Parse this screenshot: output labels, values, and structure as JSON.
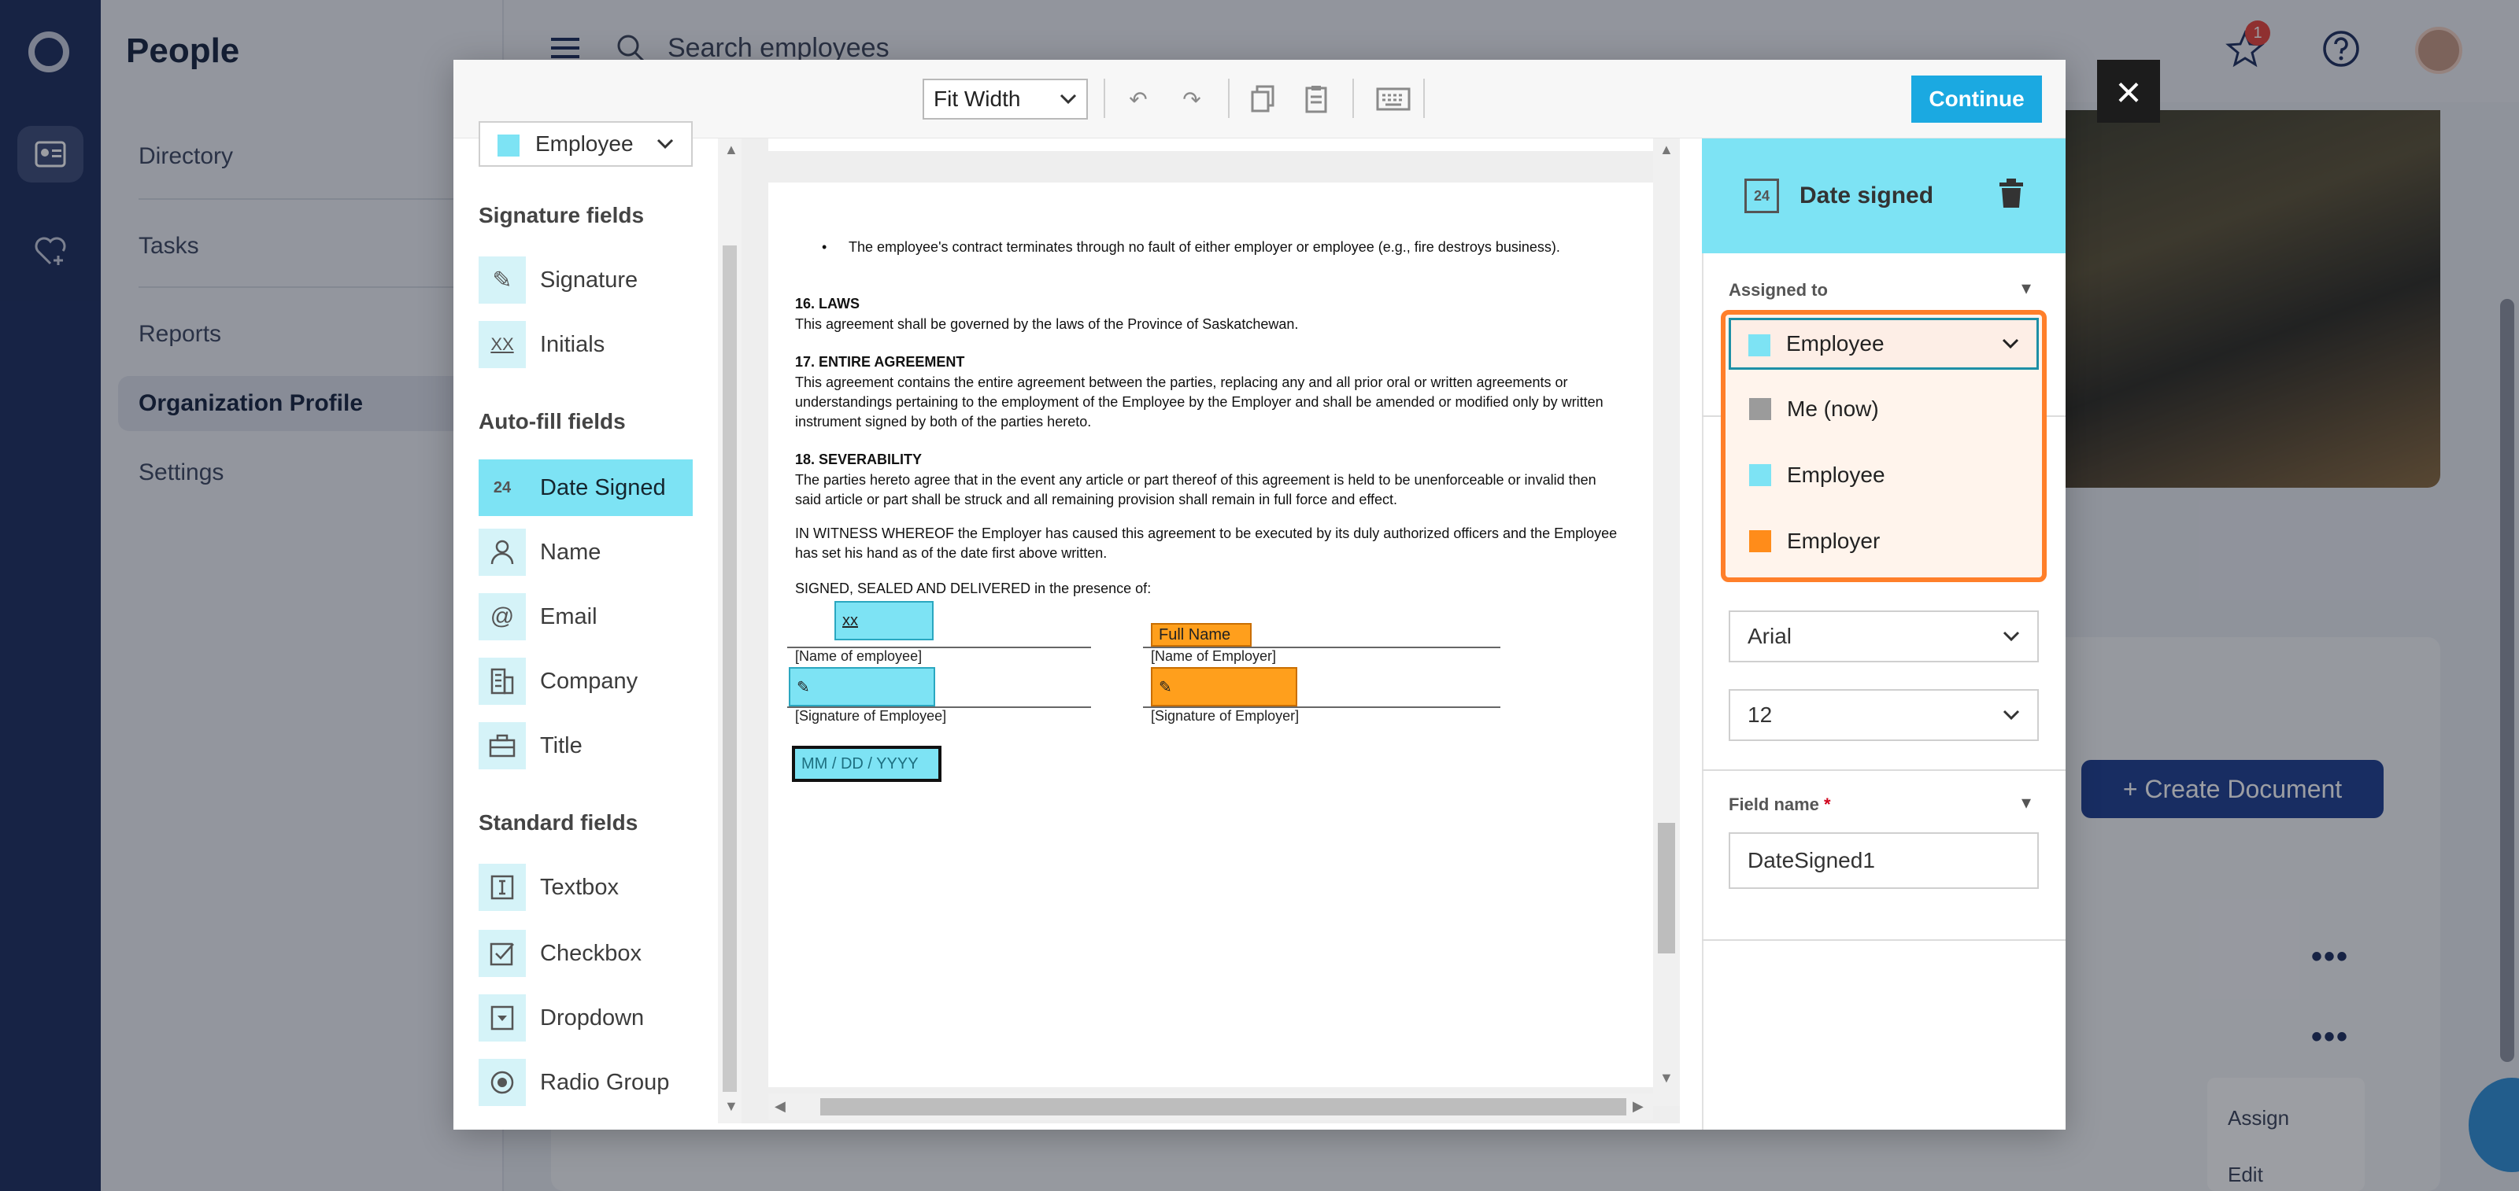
{
  "app": {
    "title": "People",
    "search_placeholder": "Search employees",
    "notification_count": "1"
  },
  "sidebar": {
    "items": [
      {
        "label": "Directory"
      },
      {
        "label": "Tasks"
      },
      {
        "label": "Reports"
      },
      {
        "label": "Organization Profile"
      },
      {
        "label": "Settings"
      }
    ]
  },
  "background": {
    "create_document_label": "+ Create Document",
    "context_menu": [
      "Assign",
      "Edit"
    ]
  },
  "modal": {
    "zoom_value": "Fit Width",
    "continue_label": "Continue",
    "left_panel": {
      "assignee": "Employee",
      "sections": [
        {
          "heading": "Signature fields",
          "items": [
            "Signature",
            "Initials"
          ]
        },
        {
          "heading": "Auto-fill fields",
          "items": [
            "Date Signed",
            "Name",
            "Email",
            "Company",
            "Title"
          ]
        },
        {
          "heading": "Standard fields",
          "items": [
            "Textbox",
            "Checkbox",
            "Dropdown",
            "Radio Group"
          ]
        }
      ]
    },
    "document": {
      "bullet": "The employee's contract terminates through no fault of either employer or employee (e.g., fire destroys business).",
      "laws_heading": "16. LAWS",
      "laws_text": "This agreement shall be governed by the laws of the Province of Saskatchewan.",
      "entire_heading": "17. ENTIRE AGREEMENT",
      "entire_text": "This agreement contains the entire agreement between the parties, replacing any and all prior oral or written agreements or understandings pertaining to the employment of the Employee by the Employer and shall be amended or modified only by written instrument signed by both of the parties hereto.",
      "severability_heading": "18. SEVERABILITY",
      "severability_text": "The parties hereto agree that in the event any article or part thereof of this agreement is held to be unenforceable or invalid then said article or part shall be struck and all remaining provision shall remain in full force and effect.",
      "witness_text": "IN WITNESS WHEREOF the Employer has caused this agreement to be executed by its duly authorized officers and the Employee has set his hand as of the date first above written.",
      "signed_text": "SIGNED, SEALED AND DELIVERED in the presence of:",
      "initials_field": "xx",
      "full_name_field": "Full Name",
      "name_of_employee": "[Name of employee]",
      "name_of_employer": "[Name of Employer]",
      "signature_of_employee": "[Signature of Employee]",
      "signature_of_employer": "[Signature of Employer]",
      "date_placeholder": "MM / DD / YYYY"
    },
    "right_panel": {
      "title": "Date signed",
      "assigned_to_label": "Assigned to",
      "assigned_to_value": "Employee",
      "options": [
        {
          "label": "Me (now)",
          "color": "#9b9b9b"
        },
        {
          "label": "Employee",
          "color": "#7de3f4"
        },
        {
          "label": "Employer",
          "color": "#ff8c1a"
        }
      ],
      "font_value": "Arial",
      "size_value": "12",
      "field_name_label": "Field name",
      "field_name_value": "DateSigned1"
    }
  },
  "colors": {
    "employee": "#7de3f4",
    "employer": "#ff9f1c",
    "accent": "#1ba9e1",
    "highlight": "#ff7f2a"
  }
}
